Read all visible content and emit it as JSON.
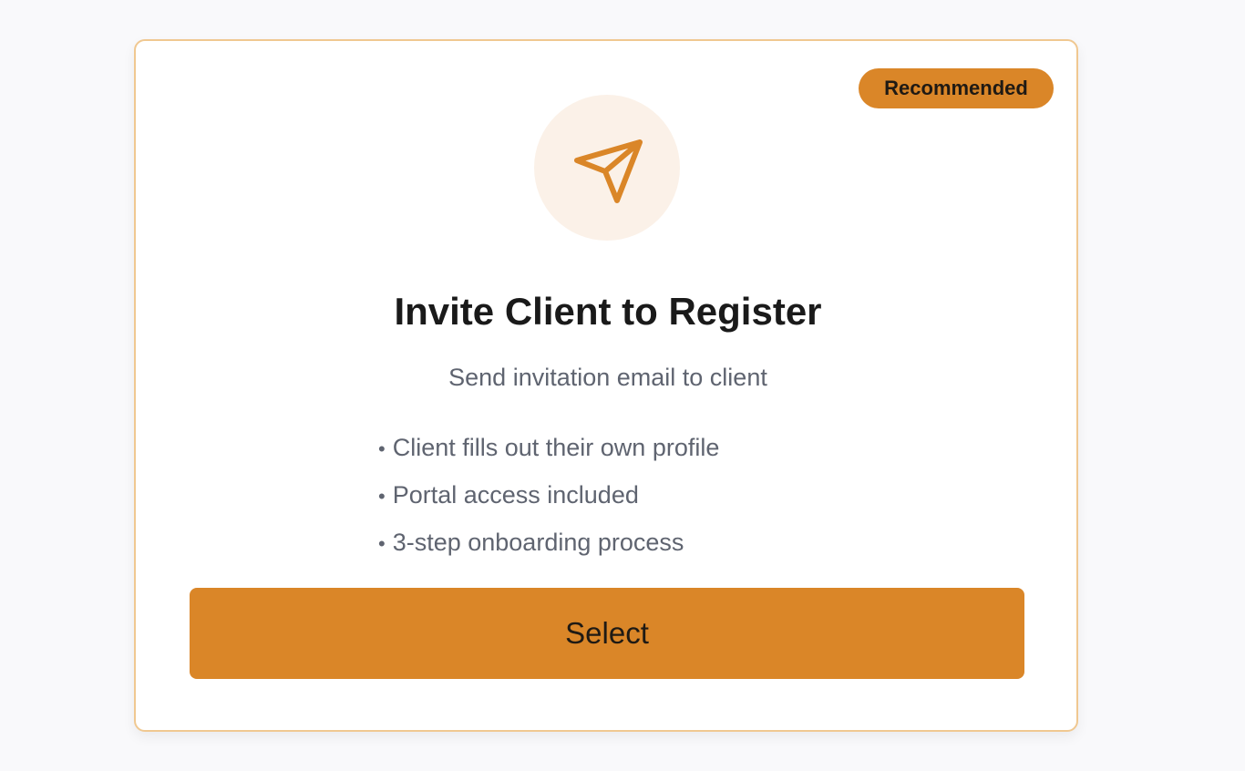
{
  "card": {
    "badge": "Recommended",
    "icon": "paper-plane-send-icon",
    "title": "Invite Client to Register",
    "subtitle": "Send invitation email to client",
    "features": [
      "Client fills out their own profile",
      "Portal access included",
      "3-step onboarding process"
    ],
    "bullet": "•",
    "select_label": "Select"
  },
  "colors": {
    "accent": "#da8628",
    "card_border": "#f0c891",
    "icon_bg": "#fbf1e8",
    "page_bg": "#f9f9fb",
    "muted_text": "#5f6470"
  }
}
